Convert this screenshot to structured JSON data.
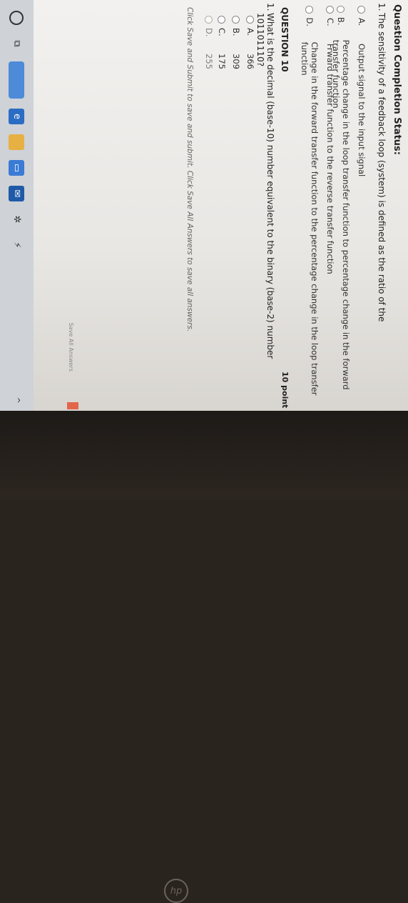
{
  "status": {
    "title": "Question Completion Status:"
  },
  "q1": {
    "number": "1.",
    "text": "The sensitivity of a feedback loop (system) is defined as the ratio of the",
    "options": [
      {
        "label": "A.",
        "text": "Output signal to the input signal"
      },
      {
        "label": "B.",
        "text": "Percentage change in the loop transfer function to percentage change in the forward transfer function"
      },
      {
        "label": "C.",
        "text": "Frward transfer function to the reverse transfer function"
      },
      {
        "label": "D.",
        "text": "Change in the forward transfer function to the percentage change in the loop transfer function"
      }
    ]
  },
  "q10": {
    "title": "QUESTION 10",
    "points": "10 point",
    "number": "1.",
    "text": "What is the decimal (base-10) number equivalent to the binary (base-2) number 101101110?",
    "options": [
      {
        "label": "A.",
        "text": "366"
      },
      {
        "label": "B.",
        "text": "309"
      },
      {
        "label": "C.",
        "text": "175"
      },
      {
        "label": "D.",
        "text": "255"
      }
    ]
  },
  "footer": {
    "text": "Click Save and Submit to save and submit. Click Save All Answers to save all answers.",
    "save_all": "Save All Answers"
  },
  "hp_logo": "hp",
  "taskbar": {
    "icons": [
      "start-icon",
      "task-view-icon",
      "edge-icon",
      "file-explorer-icon",
      "store-icon",
      "mail-icon",
      "app-icon",
      "app-icon"
    ]
  }
}
